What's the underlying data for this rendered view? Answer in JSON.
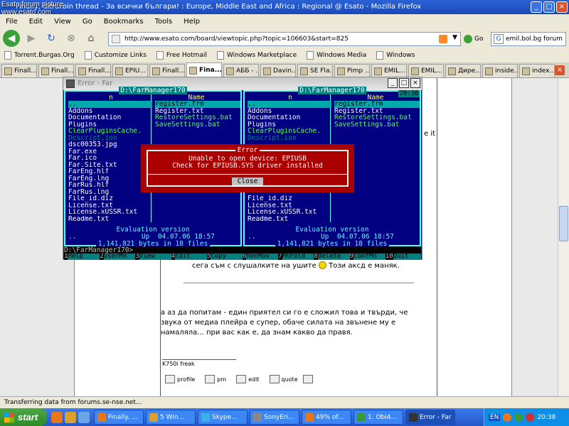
{
  "watermark": {
    "line1": "Esato forum picture",
    "line2": "www.esato.com"
  },
  "browser": {
    "title": "Finally, ultrarbin thread - За всички българи! : Europe, Middle East and Africa : Regional @ Esato - Mozilla Firefox",
    "menu": [
      "File",
      "Edit",
      "View",
      "Go",
      "Bookmarks",
      "Tools",
      "Help"
    ],
    "url": "http://www.esato.com/board/viewtopic.php?topic=106603&start=825",
    "go_label": "Go",
    "search_value": "emil.bol.bg forum",
    "bookmarks": [
      "Torrent.Burgas.Org",
      "Customize Links",
      "Free Hotmail",
      "Windows Marketplace",
      "Windows Media",
      "Windows"
    ],
    "tabs": [
      "Finall...",
      "Finall...",
      "Finall...",
      "EPIU...",
      "Finall...",
      "Fina...",
      "АББ - ...",
      "Davin...",
      "SE Fla...",
      "Pimp ...",
      "EMIL...",
      "EMIL...",
      "Дире...",
      "inside...",
      "index...."
    ],
    "active_tab": 5,
    "status": "Transferring data from forums.se-nse.net..."
  },
  "post": {
    "line_top": "сега съм с слушалките на ушите",
    "line_top_end": "Този аксд е маняк.",
    "para1": "а аз да попитам - един приятел си го е сложил това и твърди, че",
    "para2": "звука от медиа плейра е супер, обаче силата на звънене му е",
    "para3": "намаляла... при вас как е, да знам какво да правя.",
    "signature": "K750i freak",
    "actions": [
      "profile",
      "pm",
      "edit",
      "quote"
    ],
    "right_fragment": "e it"
  },
  "far": {
    "window_title": "Error - Far",
    "clock": "20:36",
    "left_path": "D:\\FarManager170",
    "right_path": "D:\\FarManager170",
    "col_n": "n",
    "col_name": "Name",
    "left_col1": [
      "..",
      "Addons",
      "Documentation",
      "Plugins",
      "ClearPluginsCache.",
      "Descript.ion",
      "dsc00353.jpg",
      "Far.exe",
      "Far.ico",
      "Far.Site.txt",
      "FarEng.hlf",
      "FarEng.lng",
      "FarRus.hlf",
      "FarRus.lng",
      "File_id.diz",
      "License.txt",
      "License.xUSSR.txt",
      "Readme.txt"
    ],
    "left_col2": [
      "register.frm",
      "Register.txt",
      "RestoreSettings.bat",
      "SaveSettings.bat"
    ],
    "right_col1": [
      "..",
      "Addons",
      "Documentation",
      "Plugins",
      "ClearPluginsCache.",
      "Descript.ion",
      "",
      "",
      "",
      "",
      "",
      "",
      "",
      "",
      "File_id.diz",
      "License.txt",
      "License.xUSSR.txt",
      "Readme.txt"
    ],
    "right_col2": [
      "register.frm",
      "Register.txt",
      "RestoreSettings.bat",
      "SaveSettings.bat"
    ],
    "eval": "Evaluation version",
    "info": "..                Up  04.07.06 18:57",
    "total": "1,141,821 bytes in 18 files",
    "prompt": "D:\\FarManager170>",
    "keys": [
      [
        "1",
        "Help"
      ],
      [
        "2",
        "UserMn"
      ],
      [
        "3",
        "View"
      ],
      [
        "4",
        "Edit"
      ],
      [
        "5",
        "Copy"
      ],
      [
        "6",
        "RenMov"
      ],
      [
        "7",
        "MkFold"
      ],
      [
        "8",
        "Delete"
      ],
      [
        "9",
        "ConfMn"
      ],
      [
        "10",
        "Quit"
      ]
    ],
    "error": {
      "title": "Error",
      "line1": "Unable to open device: EPIUSB",
      "line2": "Check for EPIUSB.SYS driver installed",
      "button": "Close"
    }
  },
  "taskbar": {
    "start": "start",
    "items": [
      "Finally. ...",
      "5 Win...",
      "Skype...",
      "SonyEri...",
      "49% of...",
      "1. Obi4...",
      "Error - Far"
    ],
    "lang": "EN",
    "time": "20:38"
  }
}
